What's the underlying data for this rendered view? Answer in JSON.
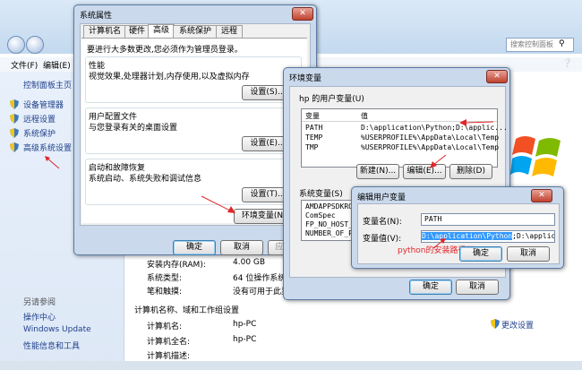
{
  "explorer": {
    "search_placeholder": "搜索控制面板",
    "menu": [
      "文件(F)",
      "编辑(E)"
    ],
    "left_pane": {
      "home": "控制面板主页",
      "links": [
        "设备管理器",
        "远程设置",
        "系统保护",
        "高级系统设置"
      ],
      "see_also_title": "另请参阅",
      "see_also": [
        "操作中心",
        "Windows Update",
        "性能信息和工具"
      ]
    },
    "main": {
      "ram_label": "安装内存(RAM):",
      "ram_value": "4.00 GB",
      "systype_label": "系统类型:",
      "systype_value": "64 位操作系统",
      "pen_label": "笔和触摸:",
      "pen_value": "没有可用于此显示",
      "section": "计算机名称、域和工作组设置",
      "computer_name_label": "计算机名:",
      "computer_name_value": "hp-PC",
      "full_name_label": "计算机全名:",
      "full_name_value": "hp-PC",
      "desc_label": "计算机描述:",
      "change_settings": "更改设置"
    }
  },
  "sysprops": {
    "title": "系统属性",
    "tabs": [
      "计算机名",
      "硬件",
      "高级",
      "系统保护",
      "远程"
    ],
    "active_tab": 2,
    "admin_note": "要进行大多数更改,您必须作为管理员登录。",
    "groups": [
      {
        "title": "性能",
        "desc": "视觉效果,处理器计划,内存使用,以及虚拟内存",
        "btn": "设置(S)..."
      },
      {
        "title": "用户配置文件",
        "desc": "与您登录有关的桌面设置",
        "btn": "设置(E)..."
      },
      {
        "title": "启动和故障恢复",
        "desc": "系统启动、系统失败和调试信息",
        "btn": "设置(T)..."
      }
    ],
    "env_btn": "环境变量(N)...",
    "ok": "确定",
    "cancel": "取消",
    "apply": "应用(A)"
  },
  "envvars": {
    "title": "环境变量",
    "user_section": "hp 的用户变量(U)",
    "col_var": "变量",
    "col_val": "值",
    "user_rows": [
      {
        "name": "PATH",
        "value": "D:\\application\\Python;D:\\applic..."
      },
      {
        "name": "TEMP",
        "value": "%USERPROFILE%\\AppData\\Local\\Temp"
      },
      {
        "name": "TMP",
        "value": "%USERPROFILE%\\AppData\\Local\\Temp"
      }
    ],
    "new_btn": "新建(N)...",
    "edit_btn": "编辑(E)...",
    "delete_btn": "删除(D)",
    "sys_section": "系统变量(S)",
    "sys_rows": [
      "AMDAPPSDKROOT",
      "ComSpec",
      "FP_NO_HOST_C...",
      "NUMBER_OF_PR..."
    ],
    "ok": "确定",
    "cancel": "取消"
  },
  "editvar": {
    "title": "编辑用户变量",
    "name_label": "变量名(N):",
    "name_value": "PATH",
    "value_label": "变量值(V):",
    "value_selected": "D:\\application\\Python",
    "value_rest": ";D:\\application",
    "annotation": "python的安装路径下",
    "ok": "确定",
    "cancel": "取消"
  },
  "colors": {
    "accent_red": "#e0262a",
    "link_blue": "#1f3f8b",
    "selection": "#3399ff"
  }
}
